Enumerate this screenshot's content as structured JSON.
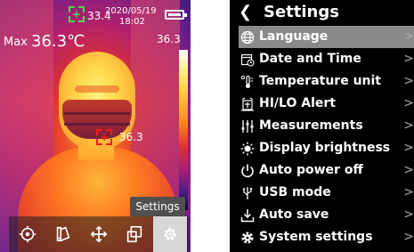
{
  "thermal": {
    "center_temp": "33.4",
    "date": "2020/05/19",
    "time": "18:02",
    "max_label": "Max",
    "max_value": "36.3℃",
    "scale_max": "36.3",
    "spot_value": "36.3",
    "tooltip": "Settings",
    "toolbar": [
      {
        "icon": "target-icon"
      },
      {
        "icon": "palette-icon"
      },
      {
        "icon": "move-icon"
      },
      {
        "icon": "image-overlay-icon"
      },
      {
        "icon": "gear-icon",
        "active": true
      }
    ],
    "battery_level": 0.75
  },
  "settings": {
    "title": "Settings",
    "items": [
      {
        "label": "Language",
        "icon": "globe-icon",
        "selected": true
      },
      {
        "label": "Date and Time",
        "icon": "calendar-icon"
      },
      {
        "label": "Temperature unit",
        "icon": "thermometer-icon"
      },
      {
        "label": "HI/LO Alert",
        "icon": "alarm-icon"
      },
      {
        "label": "Measurements",
        "icon": "sliders-icon"
      },
      {
        "label": "Display brightness",
        "icon": "brightness-icon"
      },
      {
        "label": "Auto power off",
        "icon": "power-icon"
      },
      {
        "label": "USB mode",
        "icon": "usb-icon"
      },
      {
        "label": "Auto save",
        "icon": "save-icon"
      },
      {
        "label": "System settings",
        "icon": "system-gear-icon"
      }
    ],
    "chevron": ">"
  }
}
